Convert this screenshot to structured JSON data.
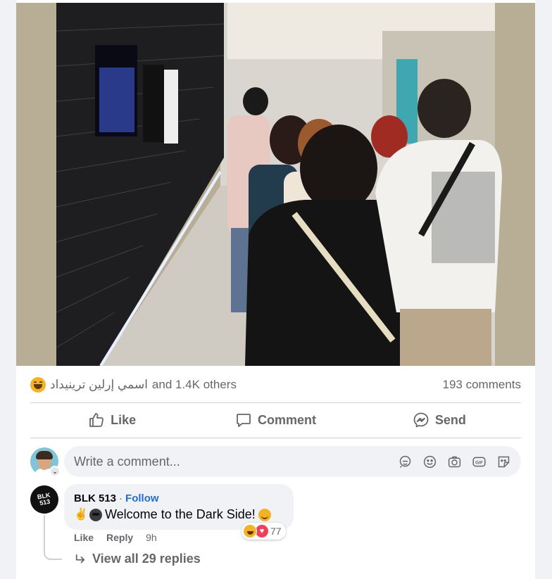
{
  "post": {
    "reactions_names": "اسمي إرلين ترينيداد",
    "reactions_others": "and 1.4K others",
    "comments_count": "193 comments"
  },
  "actions": {
    "like": "Like",
    "comment": "Comment",
    "send": "Send"
  },
  "composer": {
    "placeholder": "Write a comment...",
    "tools": [
      "avatar-sticker-icon",
      "emoji-icon",
      "camera-icon",
      "gif-icon",
      "sticker-icon"
    ],
    "gif_label": "GIF"
  },
  "comment": {
    "avatar_text_line1": "BLK",
    "avatar_text_line2": "513",
    "author": "BLK 513",
    "separator": "·",
    "follow": "Follow",
    "text": "Welcome to the Dark Side!",
    "reaction_count": "77",
    "like": "Like",
    "reply": "Reply",
    "time": "9h",
    "view_replies": "View all 29 replies"
  },
  "colors": {
    "accent": "#1877f2",
    "muted": "#65676b",
    "bubble": "#f0f2f5",
    "follow": "#216fdb"
  }
}
